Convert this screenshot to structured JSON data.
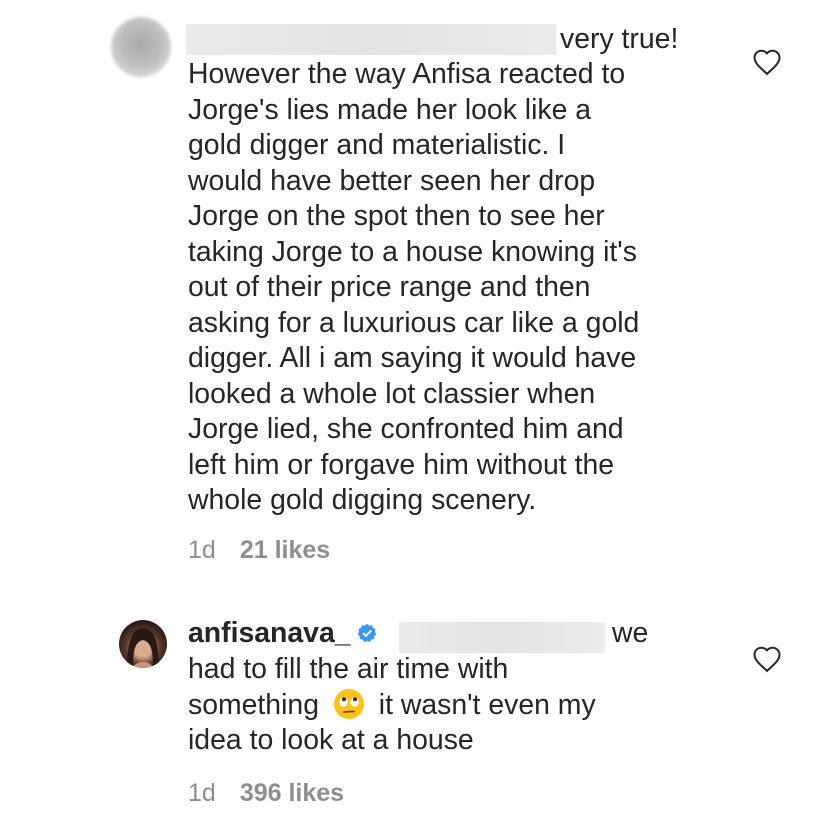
{
  "comments": [
    {
      "mention_tail": "very true!",
      "lines": [
        "However the way Anfisa reacted to",
        "Jorge's lies made her look like a",
        "gold digger and materialistic. I",
        "would have better seen her drop",
        "Jorge on the spot then to see her",
        "taking Jorge to a house knowing it's",
        "out of their price range and then",
        "asking for a luxurious car like a gold",
        "digger. All i am saying it would have",
        "looked a whole lot classier when",
        "Jorge lied, she confronted him and",
        "left him or forgave him without the",
        "whole gold digging scenery."
      ],
      "time": "1d",
      "likes": "21 likes"
    },
    {
      "username": "anfisanava_",
      "mention_tail": "we",
      "line2": "had to fill the air time with",
      "line3_pre": "something",
      "line3_post": "it wasn't even my",
      "line4": "idea to look at a house",
      "time": "1d",
      "likes": "396 likes"
    }
  ],
  "icons": {
    "like": "heart-outline-icon",
    "verified": "verified-badge-icon",
    "emoji": "eye-roll-emoji"
  },
  "colors": {
    "text": "#262626",
    "meta": "#8e8e8e",
    "verified": "#3897f0"
  }
}
